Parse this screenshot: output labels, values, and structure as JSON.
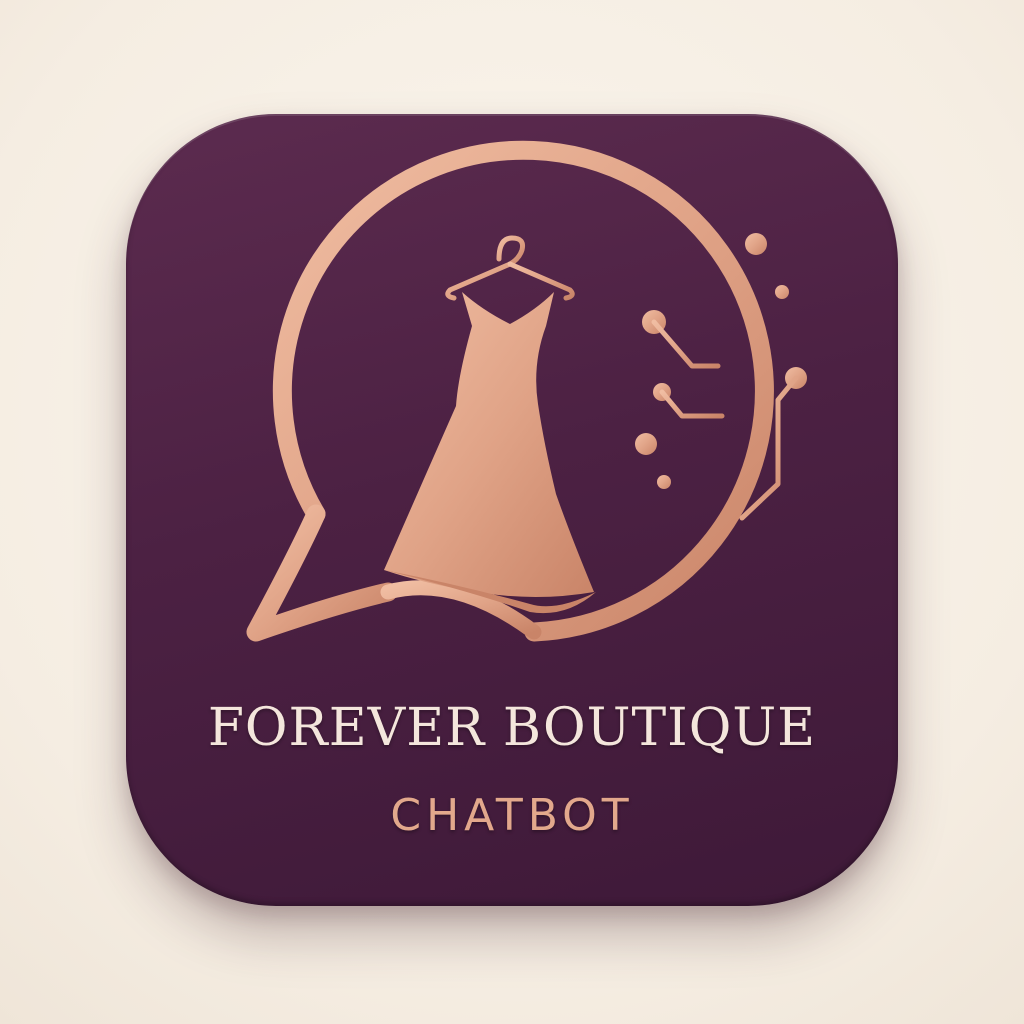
{
  "app_icon": {
    "title": "FOREVER BOUTIQUE",
    "subtitle": "CHATBOT",
    "logo_icon": "chat-bubble-dress-hanger-icon",
    "circuit_icon": "circuit-nodes-icon"
  },
  "colors": {
    "background": "#f5ede2",
    "icon_tile": "#4c2143",
    "rose_gold": "#e0a387",
    "title_text": "#f4e6dc",
    "subtitle_text": "#e2a88c"
  }
}
